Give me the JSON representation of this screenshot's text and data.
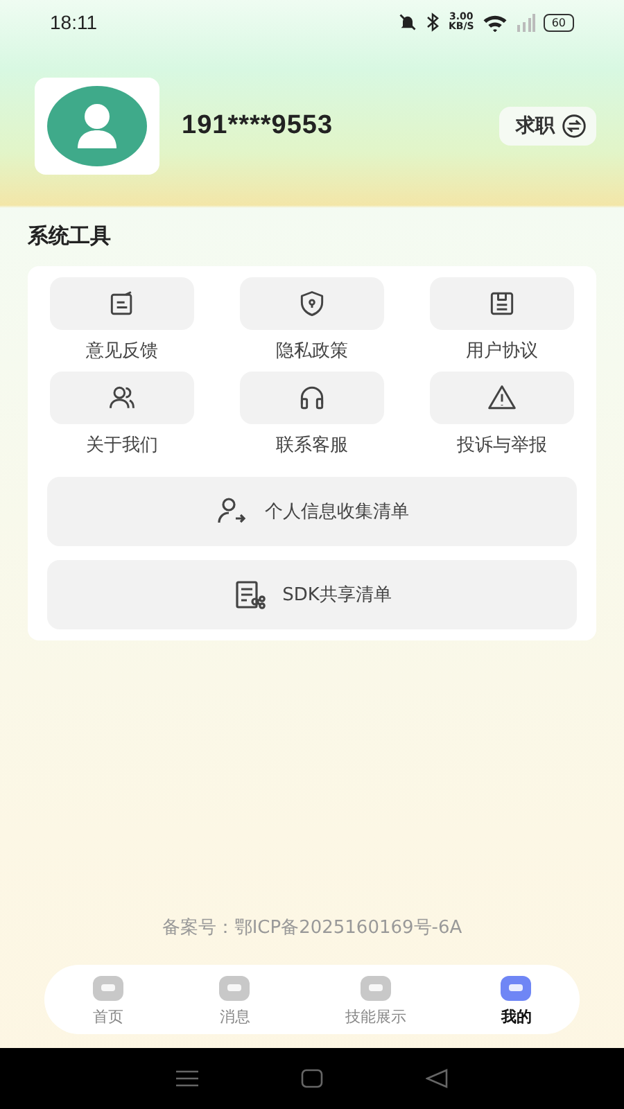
{
  "status_bar": {
    "time": "18:11",
    "speed": "3.00",
    "speed_unit": "KB/S",
    "battery": "60"
  },
  "profile": {
    "phone": "191****9553",
    "role_button": "求职"
  },
  "section_title": "系统工具",
  "tools": [
    {
      "label": "意见反馈"
    },
    {
      "label": "隐私政策"
    },
    {
      "label": "用户协议"
    },
    {
      "label": "关于我们"
    },
    {
      "label": "联系客服"
    },
    {
      "label": "投诉与举报"
    }
  ],
  "list_buttons": [
    {
      "label": "个人信息收集清单"
    },
    {
      "label": "SDK共享清单"
    }
  ],
  "icp": "备案号：鄂ICP备2025160169号-6A",
  "nav": [
    {
      "label": "首页",
      "selected": false
    },
    {
      "label": "消息",
      "selected": false
    },
    {
      "label": "技能展示",
      "selected": false
    },
    {
      "label": "我的",
      "selected": true
    }
  ]
}
